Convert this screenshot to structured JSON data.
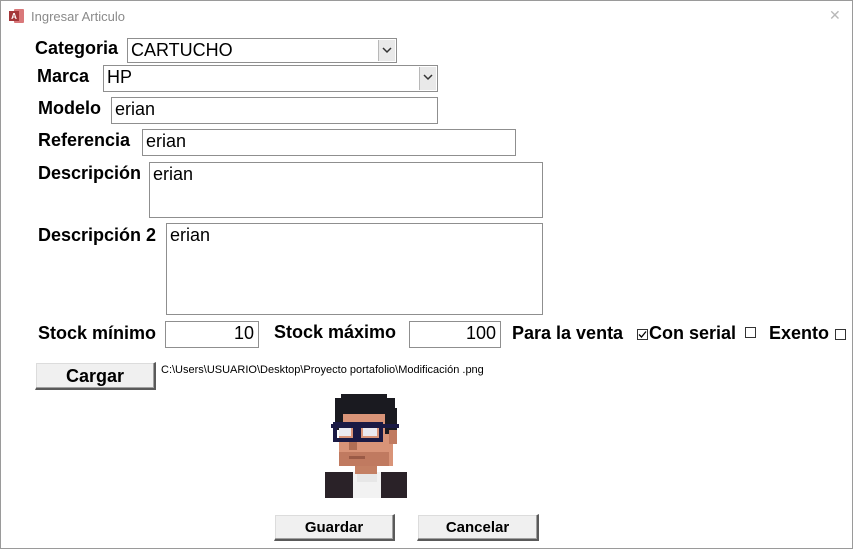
{
  "window": {
    "title": "Ingresar Articulo",
    "close_glyph": "✕"
  },
  "form": {
    "categoria": {
      "label": "Categoria",
      "value": "CARTUCHO"
    },
    "marca": {
      "label": "Marca",
      "value": "HP"
    },
    "modelo": {
      "label": "Modelo",
      "value": "erian"
    },
    "referencia": {
      "label": "Referencia",
      "value": "erian"
    },
    "descripcion": {
      "label": "Descripción",
      "value": "erian"
    },
    "descripcion2": {
      "label": "Descripción 2",
      "value": "erian"
    },
    "stock_minimo": {
      "label": "Stock mínimo",
      "value": "10"
    },
    "stock_maximo": {
      "label": "Stock máximo",
      "value": "100"
    },
    "para_la_venta": {
      "label": "Para la venta",
      "checked": true
    },
    "con_serial": {
      "label": "Con serial",
      "checked": false
    },
    "exento": {
      "label": "Exento",
      "checked": false
    }
  },
  "image": {
    "path": "C:\\Users\\USUARIO\\Desktop\\Proyecto portafolio\\Modificación .png"
  },
  "buttons": {
    "cargar": "Cargar",
    "guardar": "Guardar",
    "cancelar": "Cancelar"
  },
  "colors": {
    "app_icon": "#a4373a",
    "window_border": "#9a9a9a"
  }
}
